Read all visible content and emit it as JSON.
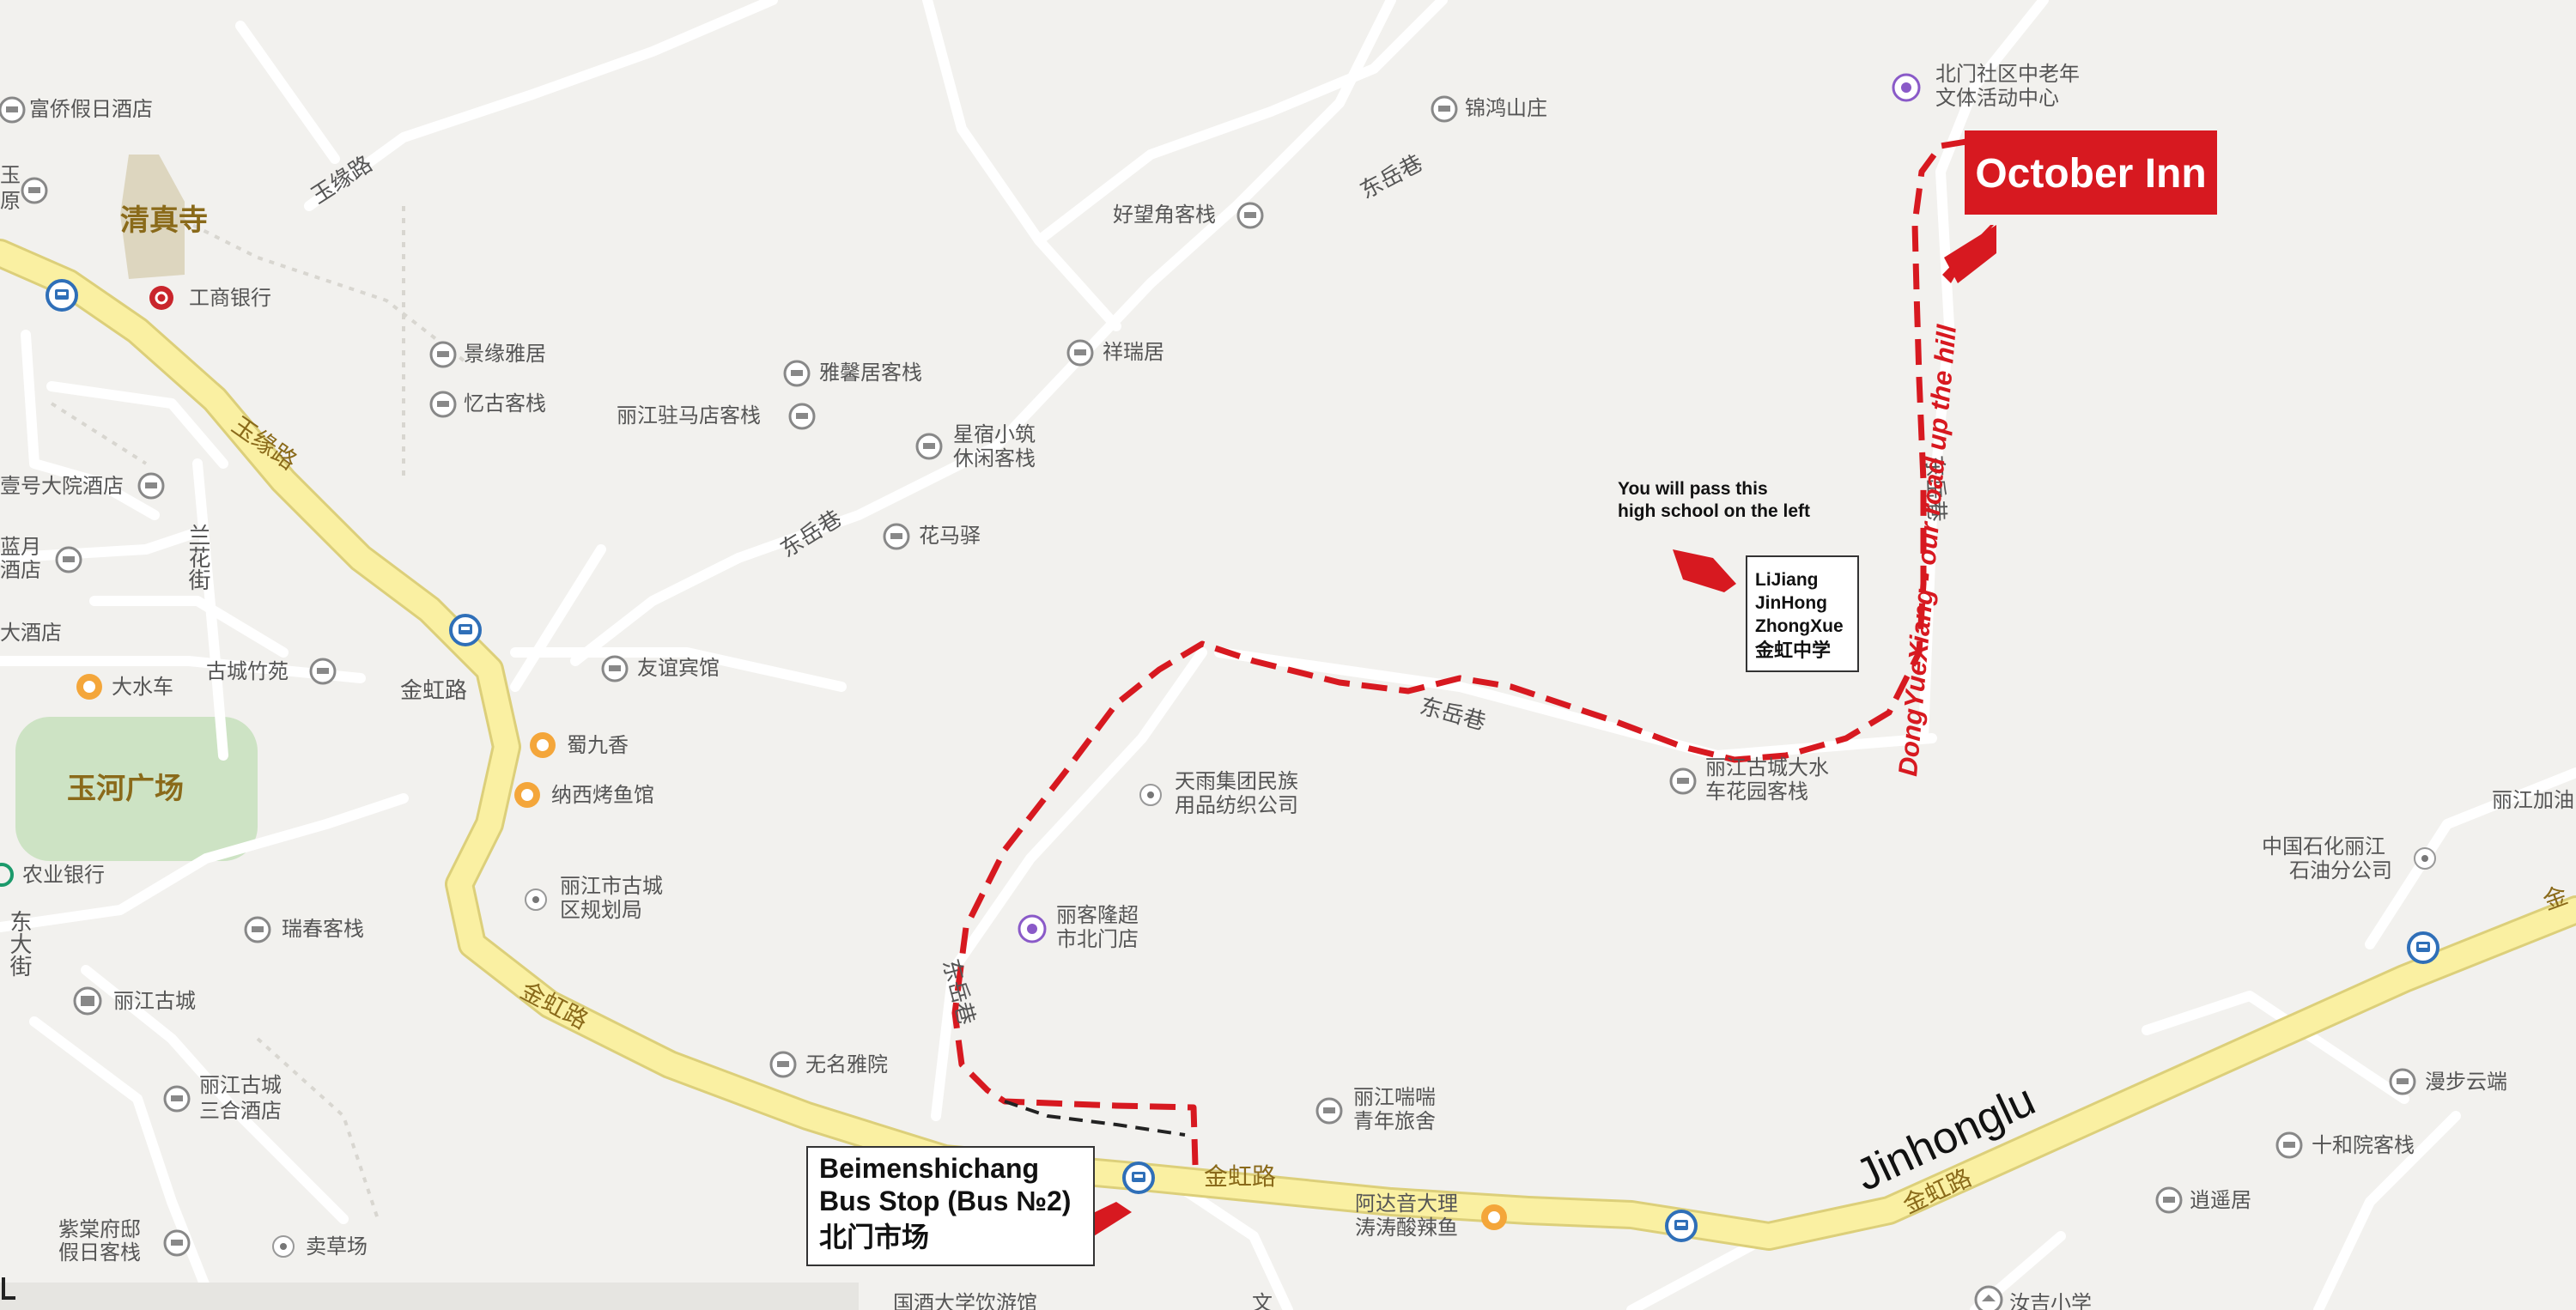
{
  "colors": {
    "background": "#f2f1ee",
    "minor_road": "#ffffff",
    "main_road": "#faf0a2",
    "main_road_edge": "#dccf7a",
    "route": "#d71920",
    "mosque_area": "#ddd6bf",
    "square": "#cde3c4",
    "bus_stop": "#2f6fb8"
  },
  "hotel": {
    "label": "October Inn"
  },
  "route_note": {
    "text": "DongYueXiang - our road up the hill"
  },
  "school_note": {
    "caption_line1": "You will pass this",
    "caption_line2": "high school on the left",
    "box_lines": [
      "LiJiang",
      "JinHong",
      "ZhongXue",
      "金虹中学"
    ]
  },
  "bus_stop_box": {
    "line1": "Beimenshichang",
    "line2": "Bus Stop (Bus №2)",
    "line3": "北门市场"
  },
  "road_jinhonglu": "Jinhonglu",
  "areas": {
    "mosque": "清真寺",
    "square": "玉河广场"
  },
  "roads": {
    "yuyuan_top": "玉缘路",
    "yuyuan_main": "玉缘路",
    "jinhong_left": "金虹路",
    "jinhong_mid": "金虹路",
    "jinhong_bottom": "金虹路",
    "jinhong_right": "金虹路",
    "jinhong_edge": "金",
    "dongyue_top": "东岳巷",
    "dongyue_mid": "东岳巷",
    "dongyue_road": "东岳巷",
    "dongyue_right": "东岳巷",
    "dongyue_left": "东岳巷",
    "lanhua": "兰花街",
    "dongda": "东大街"
  },
  "pois": {
    "fuqiao": "富侨假日酒店",
    "gongshang": "工商银行",
    "jingyuan": "景缘雅居",
    "yigu": "忆古客栈",
    "hao_dayuan": "壹号大院酒店",
    "lanyue": "蓝月",
    "lanyue2": "酒店",
    "dajiudian": "大酒店",
    "dashuiche": "大水车",
    "guchengzhuyuan": "古城竹苑",
    "nongye": "农业银行",
    "ruichun": "瑞春客栈",
    "lijianggucheng": "丽江古城",
    "sanhe1": "丽江古城",
    "sanhe2": "三合酒店",
    "zijinfu1": "紫棠府邸",
    "zijinfu2": "假日客栈",
    "maicaochang": "卖草场",
    "jinhong_shan": "锦鸿山庄",
    "haowangjiao": "好望角客栈",
    "xiangrui": "祥瑞居",
    "yaxinju": "雅馨居客栈",
    "zhumadian": "丽江驻马店客栈",
    "xingsu1": "星宿小筑",
    "xingsu2": "休闲客栈",
    "huamayi": "花马驿",
    "youyi": "友谊宾馆",
    "shujiuxiang": "蜀九香",
    "naxi": "纳西烤鱼馆",
    "guihua1": "丽江市古城",
    "guihua2": "区规划局",
    "wuming": "无名雅院",
    "tianyu1": "天雨集团民族",
    "tianyu2": "用品纺织公司",
    "lijiang_chaoshi1": "丽客隆超",
    "lijiang_chaoshi2": "市北门店",
    "chuanchuan1": "丽江喘喘",
    "chuanchuan2": "青年旅舍",
    "adayin1": "阿达音大理",
    "adayin2": "涛涛酸辣鱼",
    "dashui1": "丽江古城大水",
    "dashui2": "车花园客栈",
    "beimen1": "北门社区中老年",
    "beimen2": "文体活动中心",
    "sinopec1": "中国石化丽江",
    "sinopec2": "石油分公司",
    "jiayou": "丽江加油",
    "manbu": "漫步云端",
    "shihe": "十和院客栈",
    "xiaoyao": "逍遥居",
    "ruji": "汝吉小学",
    "bottom_road": "国酒大学饮游馆",
    "wen": "文",
    "yu_edge": "玉",
    "yuan_edge": "原"
  }
}
